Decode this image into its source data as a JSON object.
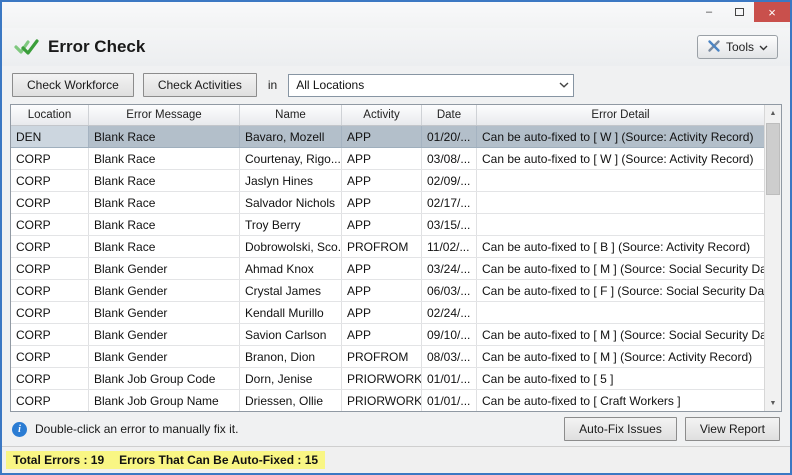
{
  "colors": {
    "window_border": "#3b78c3",
    "close_button": "#c9504c",
    "check_icon_green": "#3a9e3a",
    "selected_row": "#b3bfca",
    "info_icon_blue": "#2b7cd3",
    "status_highlight": "#f9f684"
  },
  "titlebar": {
    "minimize_glyph": "–",
    "close_glyph": "×"
  },
  "header": {
    "title": "Error Check",
    "tools_label": "Tools"
  },
  "toolbar": {
    "check_workforce_label": "Check Workforce",
    "check_activities_label": "Check Activities",
    "in_label": "in",
    "location_value": "All Locations"
  },
  "table": {
    "columns": [
      "Location",
      "Error Message",
      "Name",
      "Activity",
      "Date",
      "Error Detail"
    ],
    "selected_row_index": 0,
    "rows": [
      [
        "DEN",
        "Blank Race",
        "Bavaro, Mozell",
        "APP",
        "01/20/...",
        "Can be auto-fixed to [ W ] (Source: Activity Record)"
      ],
      [
        "CORP",
        "Blank Race",
        "Courtenay, Rigo...",
        "APP",
        "03/08/...",
        "Can be auto-fixed to [ W ] (Source: Activity Record)"
      ],
      [
        "CORP",
        "Blank Race",
        "Jaslyn Hines",
        "APP",
        "02/09/...",
        ""
      ],
      [
        "CORP",
        "Blank Race",
        "Salvador Nichols",
        "APP",
        "02/17/...",
        ""
      ],
      [
        "CORP",
        "Blank Race",
        "Troy Berry",
        "APP",
        "03/15/...",
        ""
      ],
      [
        "CORP",
        "Blank Race",
        "Dobrowolski, Sco...",
        "PROFROM",
        "11/02/...",
        "Can be auto-fixed to [ B ] (Source: Activity Record)"
      ],
      [
        "CORP",
        "Blank Gender",
        "Ahmad Knox",
        "APP",
        "03/24/...",
        "Can be auto-fixed to [ M ] (Source: Social Security Dat..."
      ],
      [
        "CORP",
        "Blank Gender",
        "Crystal James",
        "APP",
        "06/03/...",
        "Can be auto-fixed to [ F ] (Source: Social Security Data..."
      ],
      [
        "CORP",
        "Blank Gender",
        "Kendall Murillo",
        "APP",
        "02/24/...",
        ""
      ],
      [
        "CORP",
        "Blank Gender",
        "Savion Carlson",
        "APP",
        "09/10/...",
        "Can be auto-fixed to [ M ] (Source: Social Security Dat..."
      ],
      [
        "CORP",
        "Blank Gender",
        "Branon, Dion",
        "PROFROM",
        "08/03/...",
        "Can be auto-fixed to [ M ] (Source: Activity Record)"
      ],
      [
        "CORP",
        "Blank Job Group Code",
        "Dorn, Jenise",
        "PRIORWORKF...",
        "01/01/...",
        "Can be auto-fixed to [ 5 ]"
      ],
      [
        "CORP",
        "Blank Job Group Name",
        "Driessen, Ollie",
        "PRIORWORKF...",
        "01/01/...",
        "Can be auto-fixed to [ Craft Workers ]"
      ]
    ]
  },
  "footer": {
    "hint": "Double-click an error to manually fix it.",
    "auto_fix_label": "Auto-Fix Issues",
    "view_report_label": "View Report"
  },
  "statusbar": {
    "total_errors": "Total Errors : 19",
    "auto_fixable": "Errors That Can Be Auto-Fixed : 15"
  }
}
